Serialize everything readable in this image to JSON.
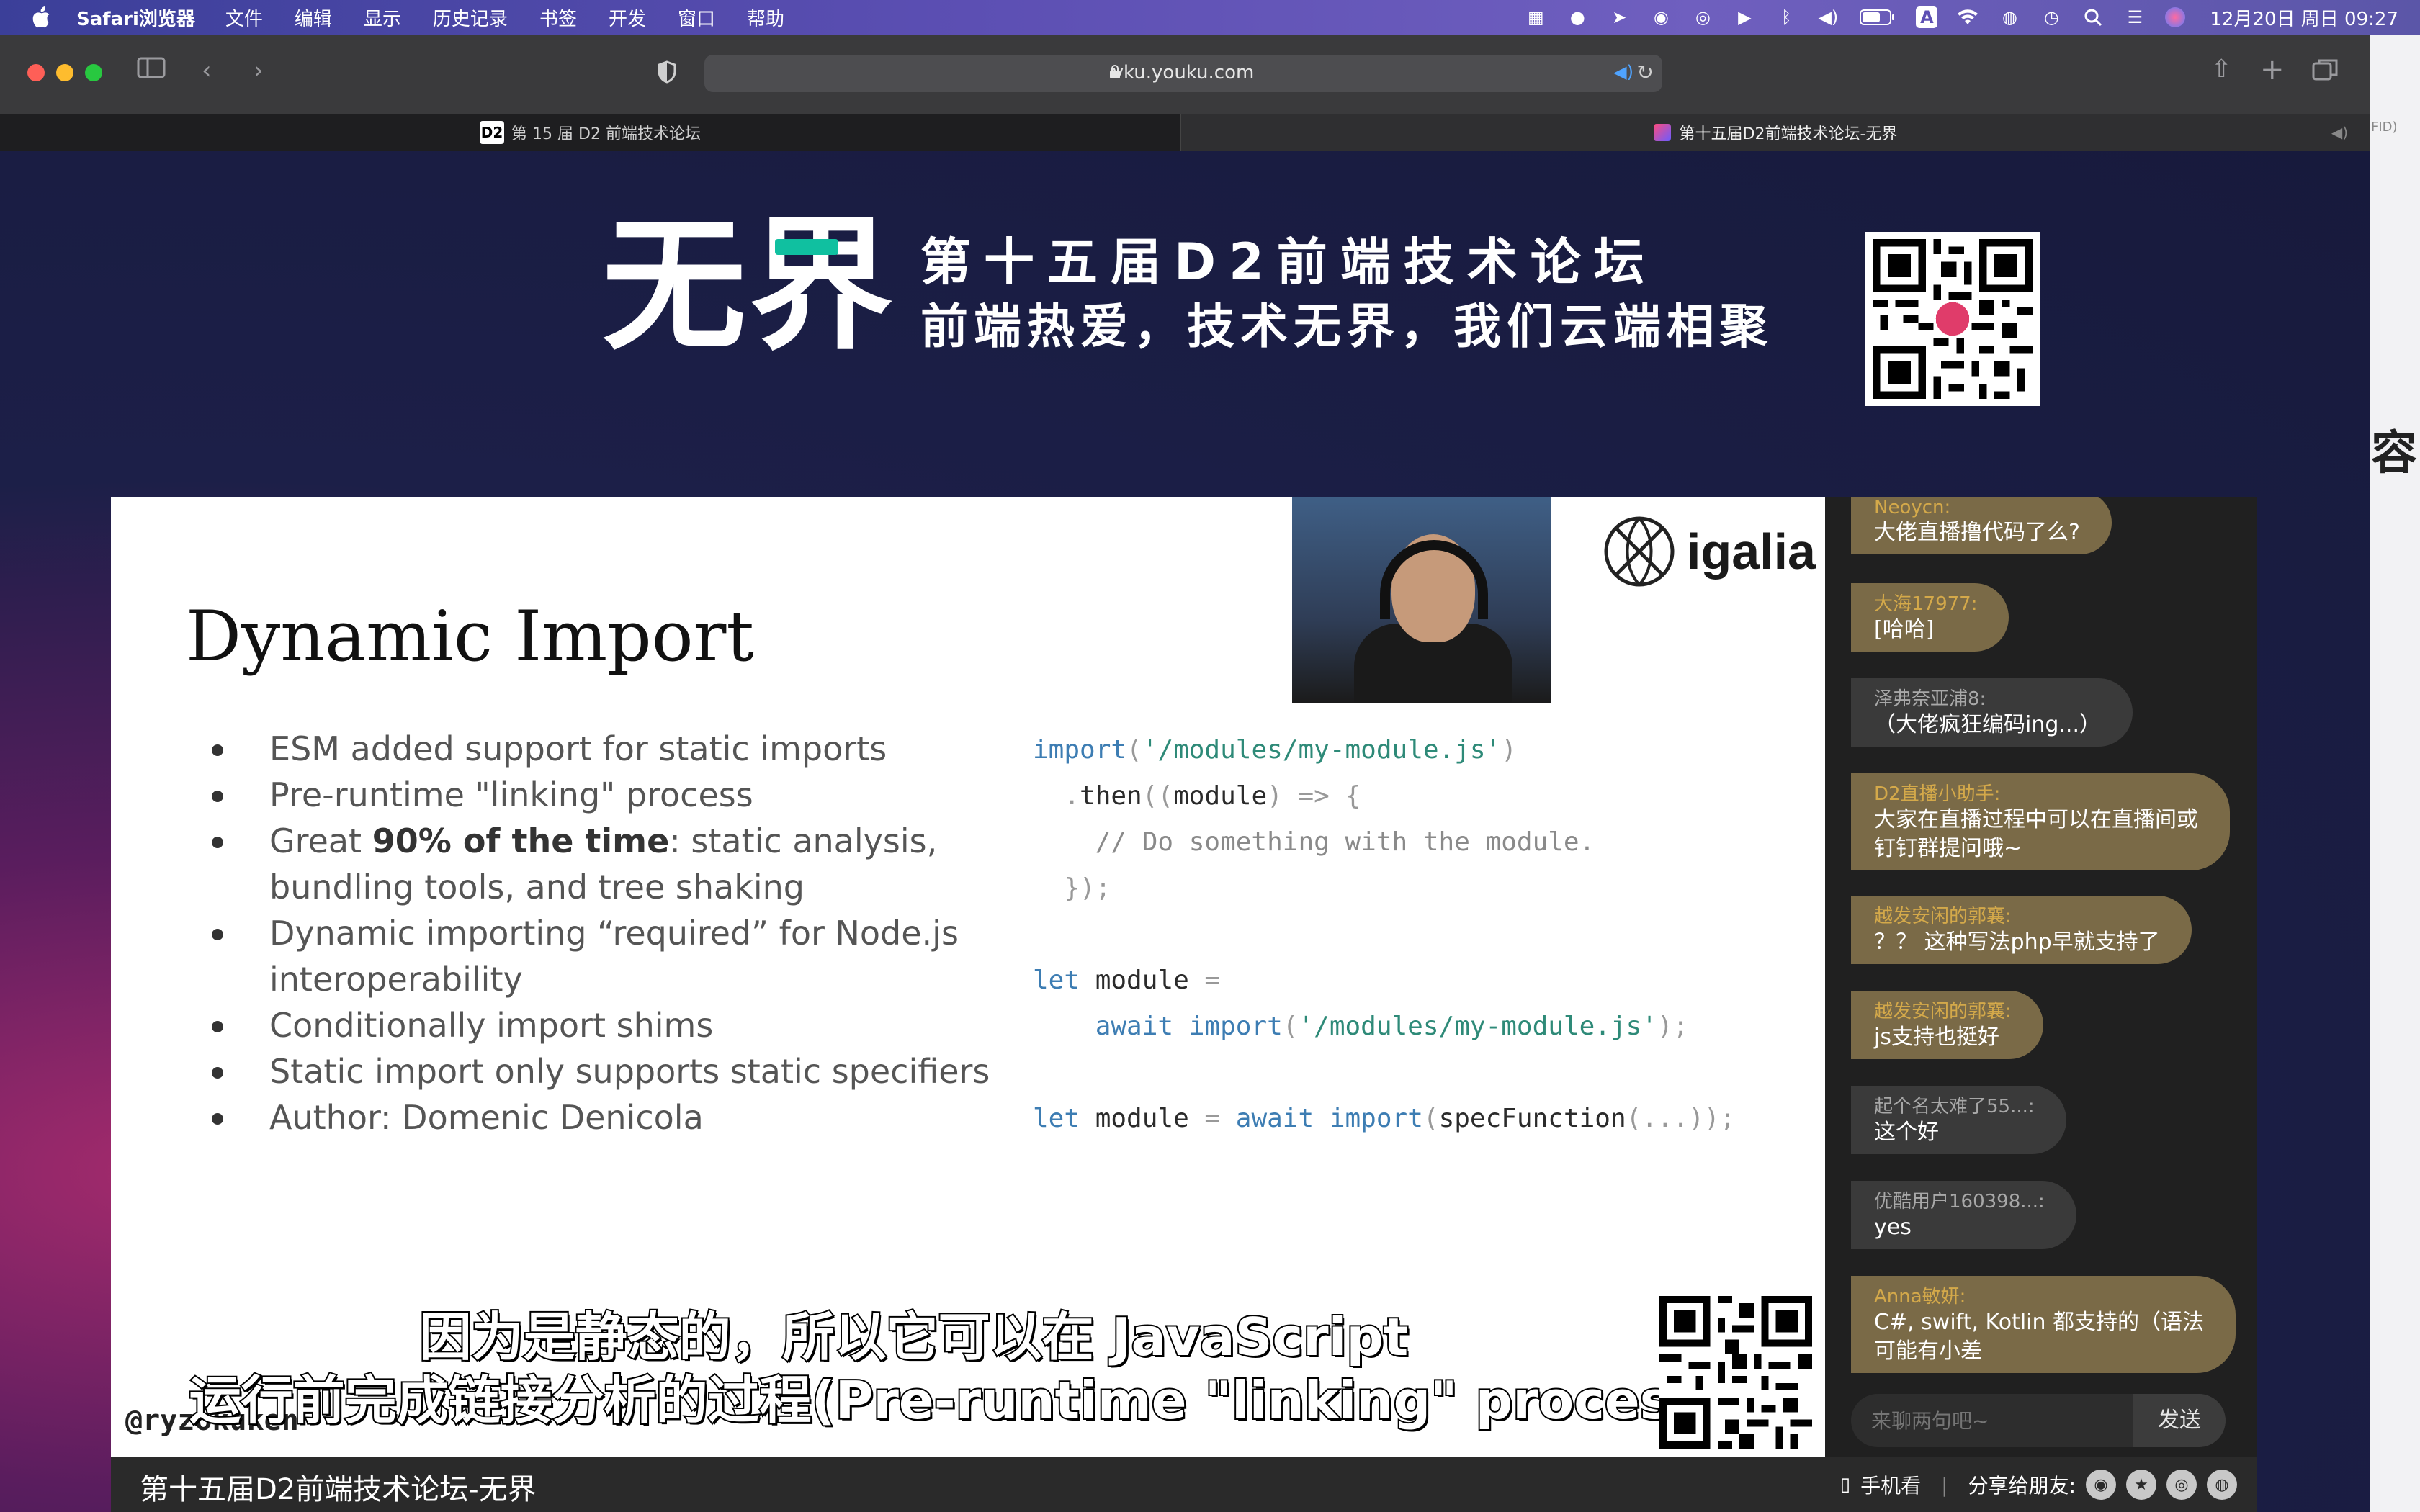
{
  "menubar": {
    "app_name": "Safari浏览器",
    "items": [
      "文件",
      "编辑",
      "显示",
      "历史记录",
      "书签",
      "开发",
      "窗口",
      "帮助"
    ],
    "clock": "12月20日 周日  09:27",
    "status_icons": [
      "trello-icon",
      "vpn-icon",
      "send-icon",
      "wechat-icon",
      "qq-icon",
      "play-icon",
      "bluetooth-icon",
      "volume-icon",
      "battery-icon",
      "input-method-icon",
      "wifi-icon",
      "user-icon",
      "time-machine-icon",
      "search-icon",
      "control-center-icon",
      "siri-icon"
    ]
  },
  "browser": {
    "url": "vku.youku.com",
    "tabs": [
      {
        "label": "第 15 届 D2 前端技术论坛",
        "favicon": "D2"
      },
      {
        "label": "第十五届D2前端技术论坛-无界"
      }
    ],
    "edge_char": "容",
    "edge_label": "FID)"
  },
  "banner": {
    "brand": "无界",
    "forum_title": "第十五届D2前端技术论坛",
    "slogan": "前端热爱，技术无界，我们云端相聚"
  },
  "slide": {
    "title": "Dynamic Import",
    "bullets": [
      {
        "pre": "ESM added support for static imports",
        "bold": "",
        "post": ""
      },
      {
        "pre": "Pre-runtime \"linking\" process",
        "bold": "",
        "post": ""
      },
      {
        "pre": "Great ",
        "bold": "90% of the time",
        "post": ": static analysis, bundling tools, and tree shaking"
      },
      {
        "pre": "Dynamic importing “required” for Node.js interoperability",
        "bold": "",
        "post": ""
      },
      {
        "pre": "Conditionally import shims",
        "bold": "",
        "post": ""
      },
      {
        "pre": "Static import only supports static specifiers",
        "bold": "",
        "post": ""
      },
      {
        "pre": "Author: Domenic Denicola",
        "bold": "",
        "post": ""
      }
    ],
    "code": {
      "l1_kw": "import",
      "l1_p1": "(",
      "l1_str": "'/modules/my-module.js'",
      "l1_p2": ")",
      "l2_p1": "  .",
      "l2_fn": "then",
      "l2_p2": "((",
      "l2_arg": "module",
      "l2_p3": ") => {",
      "l3_cm": "    // Do something with the module.",
      "l4_p": "  });",
      "l5_kw": "let",
      "l5_id": " module ",
      "l5_p": "=",
      "l6_kw": "    await import",
      "l6_p1": "(",
      "l6_str": "'/modules/my-module.js'",
      "l6_p2": ");",
      "l7_kw": "let",
      "l7_id": " module ",
      "l7_p": "= ",
      "l7_kw2": "await import",
      "l7_p2": "(",
      "l7_fn": "specFunction",
      "l7_p3": "(...));"
    },
    "company": "igalia",
    "handle": "@ryzokuken",
    "subtitle_line1": "因为是静态的，所以它可以在 JavaScript",
    "subtitle_line2": "运行前完成链接分析的过程(Pre-runtime \"linking\" process)"
  },
  "chat": {
    "messages": [
      {
        "user": "Neoycn:",
        "text": "大佬直播撸代码了么?",
        "style": "gold"
      },
      {
        "user": "大海17977:",
        "text": "[哈哈]",
        "style": "gold"
      },
      {
        "user": "泽弗奈亚浦8:",
        "text": "（大佬疯狂编码ing...）",
        "style": "grey"
      },
      {
        "user": "D2直播小助手:",
        "text": "大家在直播过程中可以在直播间或\n钉钉群提问哦~",
        "style": "gold"
      },
      {
        "user": "越发安闲的郭襄:",
        "text": "？？ 这种写法php早就支持了",
        "style": "gold"
      },
      {
        "user": "越发安闲的郭襄:",
        "text": "js支持也挺好",
        "style": "gold"
      },
      {
        "user": "起个名太难了55...:",
        "text": "这个好",
        "style": "grey"
      },
      {
        "user": "优酷用户160398...:",
        "text": "yes",
        "style": "grey"
      },
      {
        "user": "Anna敏妍:",
        "text": "C#, swift, Kotlin 都支持的（语法\n可能有小差",
        "style": "gold"
      }
    ],
    "input_placeholder": "来聊两句吧~",
    "send_label": "发送"
  },
  "bottombar": {
    "video_title": "第十五届D2前端技术论坛-无界",
    "mobile_label": "手机看",
    "separator": "|",
    "share_label": "分享给朋友:",
    "share_icons": [
      "wechat-icon",
      "star-icon",
      "weibo-icon",
      "qq-icon"
    ]
  },
  "colors": {
    "chat_user_gold": "#d4a94a",
    "chat_bubble_gold": "#7a6a47",
    "code_keyword": "#3d7db3",
    "code_string": "#2e8a78"
  }
}
